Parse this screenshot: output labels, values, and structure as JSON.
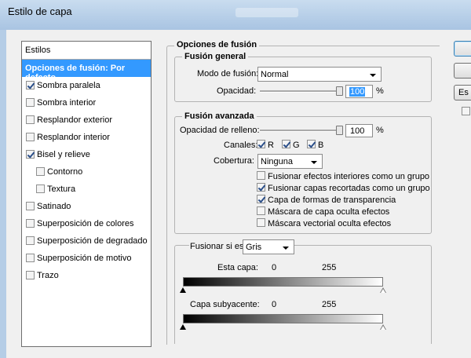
{
  "window": {
    "title": "Estilo de capa"
  },
  "styles_list": {
    "header": "Estilos",
    "items": [
      {
        "label": "Opciones de fusión: Por defecto",
        "checkbox": false,
        "checked": false,
        "selected": true,
        "indent": 0
      },
      {
        "label": "Sombra paralela",
        "checkbox": true,
        "checked": true,
        "selected": false,
        "indent": 0
      },
      {
        "label": "Sombra interior",
        "checkbox": true,
        "checked": false,
        "selected": false,
        "indent": 0
      },
      {
        "label": "Resplandor exterior",
        "checkbox": true,
        "checked": false,
        "selected": false,
        "indent": 0
      },
      {
        "label": "Resplandor interior",
        "checkbox": true,
        "checked": false,
        "selected": false,
        "indent": 0
      },
      {
        "label": "Bisel y relieve",
        "checkbox": true,
        "checked": true,
        "selected": false,
        "indent": 0
      },
      {
        "label": "Contorno",
        "checkbox": true,
        "checked": false,
        "selected": false,
        "indent": 1
      },
      {
        "label": "Textura",
        "checkbox": true,
        "checked": false,
        "selected": false,
        "indent": 1
      },
      {
        "label": "Satinado",
        "checkbox": true,
        "checked": false,
        "selected": false,
        "indent": 0
      },
      {
        "label": "Superposición de colores",
        "checkbox": true,
        "checked": false,
        "selected": false,
        "indent": 0
      },
      {
        "label": "Superposición de degradado",
        "checkbox": true,
        "checked": false,
        "selected": false,
        "indent": 0
      },
      {
        "label": "Superposición de motivo",
        "checkbox": true,
        "checked": false,
        "selected": false,
        "indent": 0
      },
      {
        "label": "Trazo",
        "checkbox": true,
        "checked": false,
        "selected": false,
        "indent": 0
      }
    ]
  },
  "blend_options": {
    "title": "Opciones de fusión",
    "general": {
      "title": "Fusión general",
      "mode_label": "Modo de fusión:",
      "mode_value": "Normal",
      "opacity_label": "Opacidad:",
      "opacity_value": "100",
      "opacity_level": 1.0,
      "percent": "%"
    },
    "advanced": {
      "title": "Fusión avanzada",
      "fill_label": "Opacidad de relleno:",
      "fill_value": "100",
      "fill_level": 1.0,
      "percent": "%",
      "channels_label": "Canales:",
      "channels": [
        {
          "label": "R",
          "checked": true
        },
        {
          "label": "G",
          "checked": true
        },
        {
          "label": "B",
          "checked": true
        }
      ],
      "knockout_label": "Cobertura:",
      "knockout_value": "Ninguna",
      "options": [
        {
          "label": "Fusionar efectos interiores como un grupo",
          "checked": false
        },
        {
          "label": "Fusionar capas recortadas como un grupo",
          "checked": true
        },
        {
          "label": "Capa de formas de transparencia",
          "checked": true
        },
        {
          "label": "Máscara de capa oculta efectos",
          "checked": false
        },
        {
          "label": "Máscara vectorial oculta efectos",
          "checked": false
        }
      ]
    },
    "blend_if": {
      "label": "Fusionar si es:",
      "value": "Gris",
      "this_layer_label": "Esta capa:",
      "this_layer_min": "0",
      "this_layer_max": "255",
      "underlying_label": "Capa subyacente:",
      "underlying_min": "0",
      "underlying_max": "255"
    }
  },
  "right_buttons": {
    "partial_label": "Es"
  },
  "colors": {
    "selection": "#3399ff",
    "titlebar": "#b7cfe8"
  }
}
